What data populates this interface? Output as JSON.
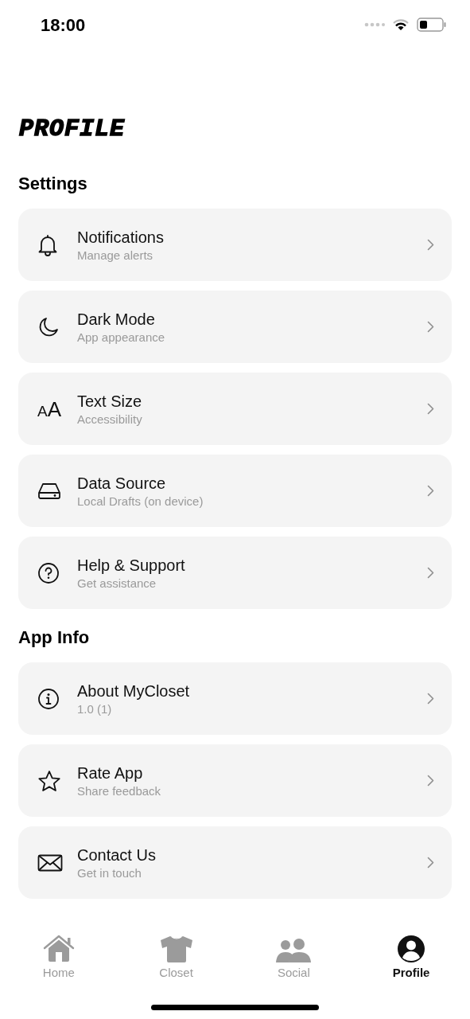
{
  "status_bar": {
    "time": "18:00"
  },
  "title": "PROFILE",
  "sections": [
    {
      "heading": "Settings",
      "items": [
        {
          "title": "Notifications",
          "subtitle": "Manage alerts"
        },
        {
          "title": "Dark Mode",
          "subtitle": "App appearance"
        },
        {
          "glyph": "AA",
          "title": "Text Size",
          "subtitle": "Accessibility"
        },
        {
          "title": "Data Source",
          "subtitle": "Local Drafts (on device)"
        },
        {
          "title": "Help & Support",
          "subtitle": "Get assistance"
        }
      ]
    },
    {
      "heading": "App Info",
      "items": [
        {
          "title": "About MyCloset",
          "subtitle": "1.0 (1)"
        },
        {
          "title": "Rate App",
          "subtitle": "Share feedback"
        },
        {
          "title": "Contact Us",
          "subtitle": "Get in touch"
        }
      ]
    }
  ],
  "tabs": [
    {
      "label": "Home",
      "selected": false
    },
    {
      "label": "Closet",
      "selected": false
    },
    {
      "label": "Social",
      "selected": false
    },
    {
      "label": "Profile",
      "selected": true
    }
  ]
}
